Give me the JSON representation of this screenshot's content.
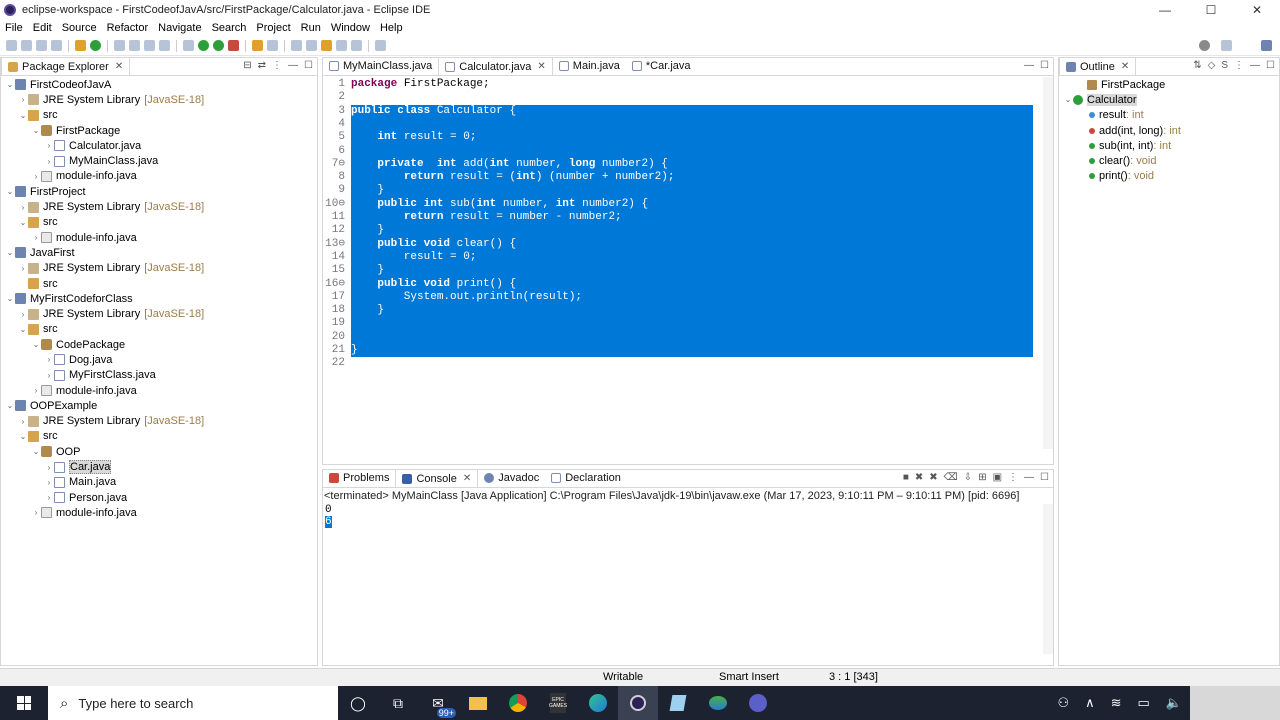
{
  "window": {
    "title": "eclipse-workspace - FirstCodeofJavA/src/FirstPackage/Calculator.java - Eclipse IDE",
    "controls": [
      "—",
      "☐",
      "✕"
    ]
  },
  "menu": [
    "File",
    "Edit",
    "Source",
    "Refactor",
    "Navigate",
    "Search",
    "Project",
    "Run",
    "Window",
    "Help"
  ],
  "package_explorer": {
    "title": "Package Explorer",
    "rows": [
      {
        "indent": 0,
        "arrow": "⌄",
        "icon": "proj",
        "label": "FirstCodeofJavA",
        "extra": ""
      },
      {
        "indent": 1,
        "arrow": "›",
        "icon": "lib",
        "label": "JRE System Library",
        "extra": "[JavaSE-18]"
      },
      {
        "indent": 1,
        "arrow": "⌄",
        "icon": "src",
        "label": "src",
        "extra": ""
      },
      {
        "indent": 2,
        "arrow": "⌄",
        "icon": "pkg",
        "label": "FirstPackage",
        "extra": ""
      },
      {
        "indent": 3,
        "arrow": "›",
        "icon": "java",
        "label": "Calculator.java",
        "extra": ""
      },
      {
        "indent": 3,
        "arrow": "›",
        "icon": "java",
        "label": "MyMainClass.java",
        "extra": ""
      },
      {
        "indent": 2,
        "arrow": "›",
        "icon": "mod",
        "label": "module-info.java",
        "extra": ""
      },
      {
        "indent": 0,
        "arrow": "⌄",
        "icon": "proj",
        "label": "FirstProject",
        "extra": ""
      },
      {
        "indent": 1,
        "arrow": "›",
        "icon": "lib",
        "label": "JRE System Library",
        "extra": "[JavaSE-18]"
      },
      {
        "indent": 1,
        "arrow": "⌄",
        "icon": "src",
        "label": "src",
        "extra": ""
      },
      {
        "indent": 2,
        "arrow": "›",
        "icon": "mod",
        "label": "module-info.java",
        "extra": ""
      },
      {
        "indent": 0,
        "arrow": "⌄",
        "icon": "proj",
        "label": "JavaFirst",
        "extra": ""
      },
      {
        "indent": 1,
        "arrow": "›",
        "icon": "lib",
        "label": "JRE System Library",
        "extra": "[JavaSE-18]"
      },
      {
        "indent": 1,
        "arrow": "",
        "icon": "src",
        "label": "src",
        "extra": ""
      },
      {
        "indent": 0,
        "arrow": "⌄",
        "icon": "proj",
        "label": "MyFirstCodeforClass",
        "extra": ""
      },
      {
        "indent": 1,
        "arrow": "›",
        "icon": "lib",
        "label": "JRE System Library",
        "extra": "[JavaSE-18]"
      },
      {
        "indent": 1,
        "arrow": "⌄",
        "icon": "src",
        "label": "src",
        "extra": ""
      },
      {
        "indent": 2,
        "arrow": "⌄",
        "icon": "pkg",
        "label": "CodePackage",
        "extra": ""
      },
      {
        "indent": 3,
        "arrow": "›",
        "icon": "java",
        "label": "Dog.java",
        "extra": ""
      },
      {
        "indent": 3,
        "arrow": "›",
        "icon": "java",
        "label": "MyFirstClass.java",
        "extra": ""
      },
      {
        "indent": 2,
        "arrow": "›",
        "icon": "mod",
        "label": "module-info.java",
        "extra": ""
      },
      {
        "indent": 0,
        "arrow": "⌄",
        "icon": "proj",
        "label": "OOPExample",
        "extra": ""
      },
      {
        "indent": 1,
        "arrow": "›",
        "icon": "lib",
        "label": "JRE System Library",
        "extra": "[JavaSE-18]"
      },
      {
        "indent": 1,
        "arrow": "⌄",
        "icon": "src",
        "label": "src",
        "extra": ""
      },
      {
        "indent": 2,
        "arrow": "⌄",
        "icon": "pkg",
        "label": "OOP",
        "extra": ""
      },
      {
        "indent": 3,
        "arrow": "›",
        "icon": "java",
        "label": "Car.java",
        "extra": "",
        "selected": true
      },
      {
        "indent": 3,
        "arrow": "›",
        "icon": "java",
        "label": "Main.java",
        "extra": ""
      },
      {
        "indent": 3,
        "arrow": "›",
        "icon": "java",
        "label": "Person.java",
        "extra": ""
      },
      {
        "indent": 2,
        "arrow": "›",
        "icon": "mod",
        "label": "module-info.java",
        "extra": ""
      }
    ]
  },
  "editor": {
    "tabs": [
      "MyMainClass.java",
      "Calculator.java",
      "Main.java",
      "*Car.java"
    ],
    "active_tab": 1,
    "lines": [
      {
        "n": "1",
        "text": "package FirstPackage;",
        "sel": false
      },
      {
        "n": "2",
        "text": "",
        "sel": false
      },
      {
        "n": "3",
        "text": "public class Calculator {",
        "sel": true
      },
      {
        "n": "4",
        "text": "",
        "sel": true
      },
      {
        "n": "5",
        "text": "    int result = 0;",
        "sel": true
      },
      {
        "n": "6",
        "text": "",
        "sel": true
      },
      {
        "n": "7⊖",
        "text": "    private  int add(int number, long number2) {",
        "sel": true
      },
      {
        "n": "8",
        "text": "        return result = (int) (number + number2);",
        "sel": true
      },
      {
        "n": "9",
        "text": "    }",
        "sel": true
      },
      {
        "n": "10⊖",
        "text": "    public int sub(int number, int number2) {",
        "sel": true
      },
      {
        "n": "11",
        "text": "        return result = number - number2;",
        "sel": true
      },
      {
        "n": "12",
        "text": "    }",
        "sel": true
      },
      {
        "n": "13⊖",
        "text": "    public void clear() {",
        "sel": true
      },
      {
        "n": "14",
        "text": "        result = 0;",
        "sel": true
      },
      {
        "n": "15",
        "text": "    }",
        "sel": true
      },
      {
        "n": "16⊖",
        "text": "    public void print() {",
        "sel": true
      },
      {
        "n": "17",
        "text": "        System.out.println(result);",
        "sel": true
      },
      {
        "n": "18",
        "text": "    }",
        "sel": true
      },
      {
        "n": "19",
        "text": "",
        "sel": true
      },
      {
        "n": "20",
        "text": "",
        "sel": true
      },
      {
        "n": "21",
        "text": "}",
        "sel": true
      },
      {
        "n": "22",
        "text": "",
        "sel": false
      }
    ]
  },
  "outline": {
    "title": "Outline",
    "items": [
      {
        "label": "FirstPackage",
        "type": "",
        "level": 0,
        "icon": "package"
      },
      {
        "label": "Calculator",
        "type": "",
        "level": 0,
        "icon": "class",
        "selected": true
      },
      {
        "label": "result",
        "type": " : int",
        "level": 1,
        "icon": "field"
      },
      {
        "label": "add(int, long)",
        "type": " : int",
        "level": 1,
        "icon": "private-method"
      },
      {
        "label": "sub(int, int)",
        "type": " : int",
        "level": 1,
        "icon": "method"
      },
      {
        "label": "clear()",
        "type": " : void",
        "level": 1,
        "icon": "method"
      },
      {
        "label": "print()",
        "type": " : void",
        "level": 1,
        "icon": "method"
      }
    ]
  },
  "console": {
    "tabs": [
      "Problems",
      "Console",
      "Javadoc",
      "Declaration"
    ],
    "active_tab": 1,
    "header": "<terminated> MyMainClass [Java Application] C:\\Program Files\\Java\\jdk-19\\bin\\javaw.exe  (Mar 17, 2023, 9:10:11 PM – 9:10:11 PM) [pid: 6696]",
    "output": [
      "0",
      "6"
    ]
  },
  "status": {
    "mode": "Writable",
    "insert": "Smart Insert",
    "position": "3 : 1 [343]"
  },
  "taskbar": {
    "search_placeholder": "Type here to search",
    "mail_badge": "99+",
    "epic_label": "EPIC GAMES"
  },
  "colors": {
    "selection": "#0078d7",
    "keyword": "#7f0055",
    "taskbar": "#1d2230"
  }
}
